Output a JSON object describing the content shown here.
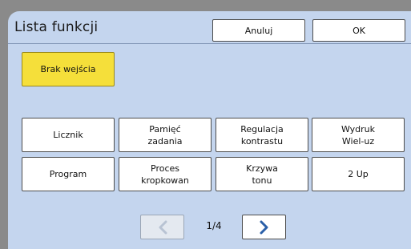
{
  "window": {
    "title": "Lista funkcji"
  },
  "header": {
    "cancel_label": "Anuluj",
    "ok_label": "OK"
  },
  "no_entry": {
    "label": "Brak wejścia",
    "color": "#f5df3a"
  },
  "functions": [
    {
      "label": "Licznik",
      "name": "function-licznik"
    },
    {
      "label": "Pamięć\nzadania",
      "name": "function-pamiec-zadania"
    },
    {
      "label": "Regulacja\nkontrastu",
      "name": "function-regulacja-kontrastu"
    },
    {
      "label": "Wydruk\nWiel-uz",
      "name": "function-wydruk-wiel-uz"
    },
    {
      "label": "Program",
      "name": "function-program"
    },
    {
      "label": "Proces\nkropkowan",
      "name": "function-proces-kropkowan"
    },
    {
      "label": "Krzywa\ntonu",
      "name": "function-krzywa-tonu"
    },
    {
      "label": "2 Up",
      "name": "function-2-up"
    }
  ],
  "pagination": {
    "indicator": "1/4",
    "prev_icon": "chevron-left-icon",
    "next_icon": "chevron-right-icon",
    "prev_enabled": false
  },
  "colors": {
    "panel_bg": "#c4d5ee",
    "next_arrow": "#2a5fa8",
    "prev_arrow_disabled": "#b8c3d3"
  }
}
